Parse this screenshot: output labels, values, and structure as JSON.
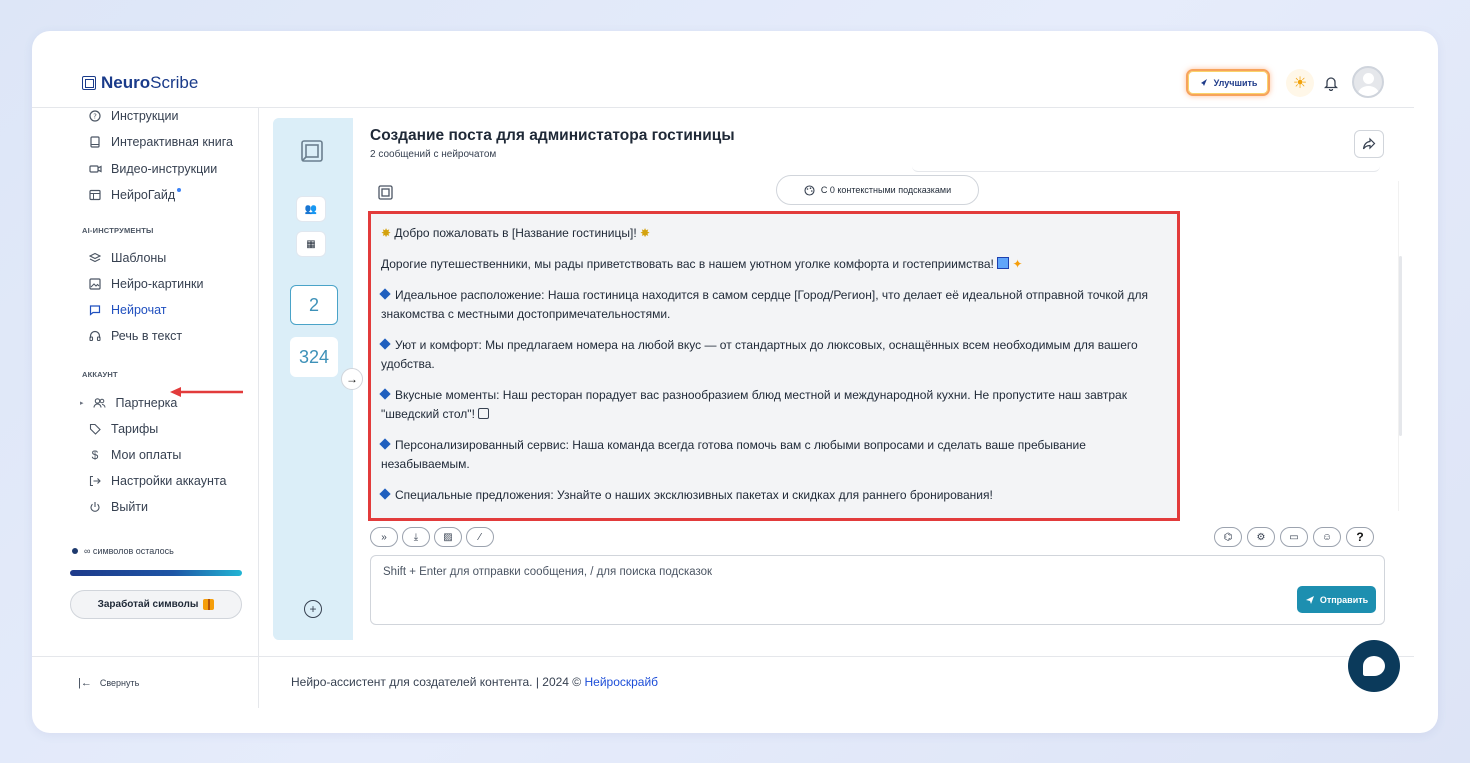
{
  "brand": {
    "bold": "Neuro",
    "regular": "Scribe"
  },
  "header": {
    "upgrade_label": "Улучшить",
    "icons": [
      "rocket-icon",
      "sun-icon",
      "bell-icon",
      "avatar"
    ]
  },
  "sidebar": {
    "top_items": [
      {
        "label": "Инструкции",
        "icon": "help-circle-icon"
      },
      {
        "label": "Интерактивная книга",
        "icon": "book-icon"
      },
      {
        "label": "Видео-инструкции",
        "icon": "video-icon"
      },
      {
        "label": "НейроГайд",
        "icon": "guide-icon"
      }
    ],
    "ai_section": "AI-ИНСТРУМЕНТЫ",
    "ai_items": [
      {
        "label": "Шаблоны",
        "icon": "layers-icon"
      },
      {
        "label": "Нейро-картинки",
        "icon": "image-icon"
      },
      {
        "label": "Нейрочат",
        "icon": "chat-icon"
      },
      {
        "label": "Речь в текст",
        "icon": "headphones-icon"
      }
    ],
    "account_section": "АККАУНТ",
    "account_items": [
      {
        "label": "Партнерка",
        "icon": "users-icon"
      },
      {
        "label": "Тарифы",
        "icon": "tag-icon"
      },
      {
        "label": "Мои оплаты",
        "icon": "dollar-icon"
      },
      {
        "label": "Настройки аккаунта",
        "icon": "login-icon"
      },
      {
        "label": "Выйти",
        "icon": "power-icon"
      }
    ],
    "symbols_left": "∞ символов осталось",
    "earn_label": "Заработай символы",
    "collapse_label": "Свернуть"
  },
  "chatlist": {
    "count_active": "2",
    "count_total": "324"
  },
  "chat": {
    "title": "Создание поста для администатора гостиницы",
    "subtitle": "2 сообщений с нейрочатом",
    "context_pill": "С 0 контекстными подсказками",
    "message": {
      "greeting": "Добро пожаловать в [Название гостиницы]!",
      "intro": "Дорогие путешественники, мы рады приветствовать вас в нашем уютном уголке комфорта и гостеприимства!",
      "points": [
        "Идеальное расположение: Наша гостиница находится в самом сердце [Город/Регион], что делает её идеальной отправной точкой для знакомства с местными достопримечательностями.",
        "Уют и комфорт: Мы предлагаем номера на любой вкус — от стандартных до люксовых, оснащённых всем необходимым для вашего удобства.",
        "Вкусные моменты: Наш ресторан порадует вас разнообразием блюд местной и международной кухни. Не пропустите наш завтрак \"шведский стол\"!",
        "Персонализированный сервис: Наша команда всегда готова помочь вам с любыми вопросами и сделать ваше пребывание незабываемым.",
        "Специальные предложения: Узнайте о наших эксклюзивных пакетах и скидках для раннего бронирования!"
      ]
    },
    "input_placeholder": "Shift + Enter для отправки сообщения, / для поиска подсказок",
    "send_label": "Отправить"
  },
  "footer": {
    "text": "Нейро-ассистент для создателей контента.  | 2024 © ",
    "link": "Нейроскрайб"
  },
  "colors": {
    "accent": "#1d8fb0",
    "highlight_border": "#e23b3b",
    "brand": "#1a3b8a"
  }
}
